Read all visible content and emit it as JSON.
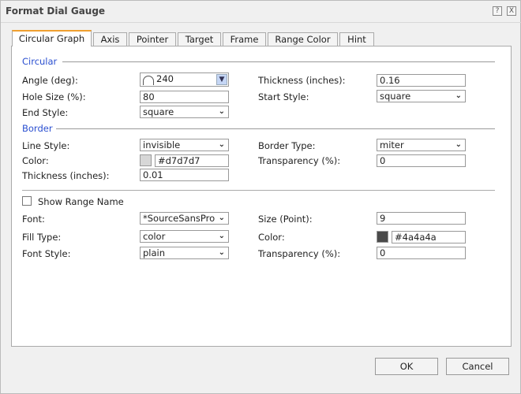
{
  "window": {
    "title": "Format Dial Gauge",
    "help": "?",
    "close": "X"
  },
  "tabs": [
    "Circular Graph",
    "Axis",
    "Pointer",
    "Target",
    "Frame",
    "Range Color",
    "Hint"
  ],
  "circular": {
    "header": "Circular",
    "angle_label": "Angle (deg):",
    "angle": "240",
    "hole_label": "Hole Size (%):",
    "hole": "80",
    "end_label": "End Style:",
    "end": "square",
    "thick_label": "Thickness (inches):",
    "thick": "0.16",
    "start_label": "Start Style:",
    "start": "square"
  },
  "border": {
    "header": "Border",
    "line_label": "Line Style:",
    "line": "invisible",
    "color_label": "Color:",
    "color": "#d7d7d7",
    "thick_label": "Thickness (inches):",
    "thick": "0.01",
    "type_label": "Border Type:",
    "type": "miter",
    "trans_label": "Transparency (%):",
    "trans": "0"
  },
  "range": {
    "show_label": "Show Range Name",
    "show": false,
    "font_label": "Font:",
    "font": "*SourceSansPro",
    "fill_label": "Fill Type:",
    "fill": "color",
    "style_label": "Font Style:",
    "style": "plain",
    "size_label": "Size (Point):",
    "size": "9",
    "color_label": "Color:",
    "color": "#4a4a4a",
    "trans_label": "Transparency (%):",
    "trans": "0"
  },
  "buttons": {
    "ok": "OK",
    "cancel": "Cancel"
  }
}
